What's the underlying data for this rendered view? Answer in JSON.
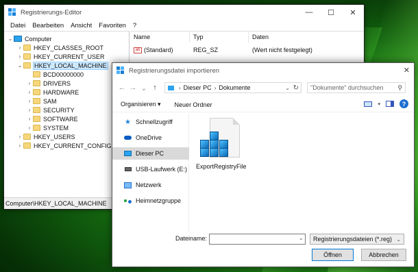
{
  "desktop": {
    "accent": "#2fa81f"
  },
  "regedit": {
    "title": "Registrierungs-Editor",
    "window_buttons": {
      "minimize": "—",
      "maximize": "☐",
      "close": "✕"
    },
    "menu": [
      "Datei",
      "Bearbeiten",
      "Ansicht",
      "Favoriten",
      "?"
    ],
    "tree": {
      "root": "Computer",
      "items": [
        {
          "label": "HKEY_CLASSES_ROOT",
          "expander": "›"
        },
        {
          "label": "HKEY_CURRENT_USER",
          "expander": "›"
        },
        {
          "label": "HKEY_LOCAL_MACHINE",
          "expander": "⌄",
          "selected": true
        },
        {
          "label": "BCD00000000",
          "expander": ""
        },
        {
          "label": "DRIVERS",
          "expander": "›"
        },
        {
          "label": "HARDWARE",
          "expander": "›"
        },
        {
          "label": "SAM",
          "expander": "›"
        },
        {
          "label": "SECURITY",
          "expander": "›"
        },
        {
          "label": "SOFTWARE",
          "expander": "›"
        },
        {
          "label": "SYSTEM",
          "expander": "›"
        },
        {
          "label": "HKEY_USERS",
          "expander": "›"
        },
        {
          "label": "HKEY_CURRENT_CONFIG",
          "expander": "›"
        }
      ]
    },
    "columns": [
      "Name",
      "Typ",
      "Daten"
    ],
    "rows": [
      {
        "name": "(Standard)",
        "type": "REG_SZ",
        "data": "(Wert nicht festgelegt)",
        "icon": "ab"
      }
    ],
    "status": "Computer\\HKEY_LOCAL_MACHINE"
  },
  "dialog": {
    "title": "Registrierungsdatei importieren",
    "close": "✕",
    "nav": {
      "back": "←",
      "forward": "→",
      "dropdown": "⌄",
      "up": "↑"
    },
    "breadcrumb": [
      "Dieser PC",
      "Dokumente"
    ],
    "breadcrumb_sep": "›",
    "search_placeholder": "\"Dokumente\" durchsuchen",
    "toolbar": {
      "organize": "Organisieren ▾",
      "new_folder": "Neuer Ordner",
      "help": "?"
    },
    "sidebar": [
      {
        "label": "Schnellzugriff",
        "icon": "star-icon",
        "glyph": "★"
      },
      {
        "label": "OneDrive",
        "icon": "cloud-icon"
      },
      {
        "label": "Dieser PC",
        "icon": "monitor-icon",
        "selected": true
      },
      {
        "label": "USB-Laufwerk (E:)",
        "icon": "usb-drive-icon"
      },
      {
        "label": "Netzwerk",
        "icon": "network-icon"
      },
      {
        "label": "Heimnetzgruppe",
        "icon": "homegroup-icon"
      }
    ],
    "file": {
      "name": "ExportRegistryFile",
      "icon": "registry-file-icon"
    },
    "filename_label": "Dateiname:",
    "filename_value": "",
    "filetype": "Registrierungsdateien (*.reg)",
    "buttons": {
      "open": "Öffnen",
      "cancel": "Abbrechen"
    }
  }
}
